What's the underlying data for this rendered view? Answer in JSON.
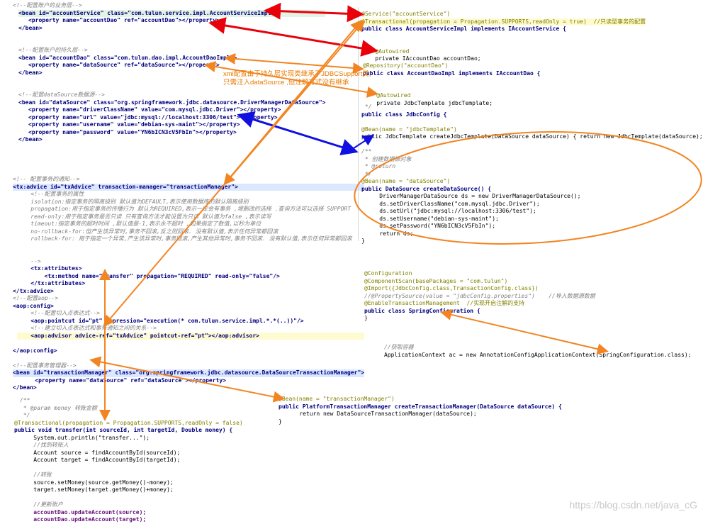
{
  "beans_xml": {
    "service_comment": "<!--配置账户的业务层-->",
    "service_bean": "<bean id=\"accountService\" class=\"com.tulun.service.impl.AccountServiceImpl\">",
    "service_prop": "<property name=\"accountDao\" ref=\"accountDao\"></property>",
    "service_end": "</bean>",
    "dao_comment": "<!--配置账户的持久层-->",
    "dao_bean": "<bean id=\"accountDao\" class=\"com.tulun.dao.impl.AccountDaoImpl\">",
    "dao_prop": "<property name=\"dataSource\" ref=\"dataSource\"></property>",
    "dao_end": "</bean>",
    "ds_comment": "<!--配置dataSource数据源-->",
    "ds_bean": "<bean id=\"dataSource\" class=\"org.springframework.jdbc.datasource.DriverManagerDataSource\">",
    "ds_props": [
      "<property name=\"driverClassName\" value=\"com.mysql.jdbc.Driver\"></property>",
      "<property name=\"url\" value=\"jdbc:mysql://localhost:3306/test\"></property>",
      "<property name=\"username\" value=\"debian-sys-maint\"></property>",
      "<property name=\"password\" value=\"YN6bICN3cV5FbIn\"></property>"
    ],
    "ds_end": "</bean>"
  },
  "tx_xml": {
    "lines": [
      "<!-- 配置事务的通知-->",
      "<tx:advice id=\"txAdvice\" transaction-manager=\"transactionManager\">",
      "    <!--配置事务的属性",
      "    isolation:指定事务的隔离级别 默认值为DEFAULT,表示使用数据库的默认隔离级别",
      "    propagation:用于指定事务的传播行为 默认为REQUIRED,表示一定会有事务 ,增删改的选择 .查询方法可以选择 SUPPORT",
      "    read-only:用于指定事务是否只读 只有查询方法才能设置为只读 默认值为false ,表示读写",
      "    timeout:指定事务的超时时间 ,默认值是-1,表示永不超时 ,如果指定了数值,以秒为单位",
      "    no-rollback-for:但产生该异常时,事务不回滚,反之则回滚. 没有默认值,表示任何异常都回滚",
      "    rollback-for: 用于指定一个异常,产生该异常时,事务回滚,产生其他异常时,事务不回滚. 没有默认值,表示任何异常都回滚",
      "",
      "",
      "    -->",
      "    <tx:attributes>",
      "        <tx:method name=\"transfer\" propagation=\"REQUIRED\" read-only=\"false\"/>",
      "    </tx:attributes>",
      "</tx:advice>",
      "<!--配置aop-->",
      "<aop:config>",
      "    <!--配置切入点表达式-->",
      "    <aop:pointcut id=\"pt\" expression=\"execution(* com.tulun.service.impl.*.*(..))\"/>",
      "    <!--建立切入点表达式和事务通知之间的关系-->",
      "    <aop:advisor advice-ref=\"txAdvice\" pointcut-ref=\"pt\"></aop:advisor>",
      "",
      "</aop:config>",
      "",
      "<!--配置事务管理器-->",
      "<bean id=\"transactionManager\" class=\"org.springframework.jdbc.datasource.DataSourceTransactionManager\">",
      "    <property name=\"dataSource\" ref=\"dataSource\"></property>",
      "</bean>"
    ]
  },
  "transfer_code": {
    "lines": [
      "/**",
      " * @param money 转账金额",
      " */",
      "@Transactional(propagation = Propagation.SUPPORTS,readOnly = false)",
      "public void transfer(int sourceId, int targetId, Double money) {",
      "    System.out.println(\"transfer...\");",
      "    //找到转账人",
      "    Account source = findAccountById(sourceId);",
      "    Account target = findAccountById(targetId);",
      "",
      "    //转账",
      "    source.setMoney(source.getMoney()-money);",
      "    target.setMoney(target.getMoney()+money);",
      "",
      "    //更新账户",
      "    accountDao.updateAccount(source);",
      "    accountDao.updateAccount(target);"
    ]
  },
  "tm_code": {
    "lines": [
      "@Bean(name = \"transactionManager\")",
      "public PlatformTransactionManager createTransactionManager(DataSource dataSource) {",
      "    return new DataSourceTransactionManager(dataSource);",
      "}"
    ]
  },
  "service_code": {
    "lines": [
      "@Service(\"accountService\")",
      "@Transactional(propagation = Propagation.SUPPORTS,readOnly = true)  //只读型事务的配置",
      "public class AccountServiceImpl implements IAccountService {",
      "",
      "",
      "    @Autowired",
      "    private IAccountDao accountDao;"
    ]
  },
  "dao_code": {
    "lines": [
      "@Repository(\"accountDao\")",
      "public class AccountDaoImpl implements IAccountDao {",
      "",
      "",
      "    @Autowired",
      "    private JdbcTemplate jdbcTemplate;"
    ]
  },
  "jdbc_code": {
    "lines": [
      " */",
      "public class JdbcConfig {",
      "",
      "@Bean(name = \"jdbcTemplate\")",
      "public JdbcTemplate createJdbcTemplate(DataSource dataSource) { return new JdbcTemplate(dataSource); }",
      "",
      "/**",
      " * 创建数据源对象",
      " * @return",
      " */",
      "@Bean(name = \"dataSource\")",
      "public DataSource createDataSource() {",
      "    DriverManagerDataSource ds = new DriverManagerDataSource();",
      "    ds.setDriverClassName(\"com.mysql.jdbc.Driver\");",
      "    ds.setUrl(\"jdbc:mysql://localhost:3306/test\");",
      "    ds.setUsername(\"debian-sys-maint\");",
      "    ds.setPassword(\"YN6bICN3cV5FbIn\");",
      "    return ds;",
      "}"
    ]
  },
  "config_code": {
    "lines": [
      "@Configuration",
      "@ComponentScan(basePackages = \"com.tulun\")",
      "@Import({JdbcConfig.class,TransactionConfig.class})",
      "//@PropertySource(value = \"jdbcConfig.properties\")    //导入数据源数据",
      "@EnableTransactionManagement  //实现开启注解的支持",
      "public class SpringConfiguration {",
      "}"
    ]
  },
  "context_code": {
    "lines": [
      "//获取容器",
      "ApplicationContext ac = new AnnotationConfigApplicationContext(SpringConfiguration.class);"
    ]
  },
  "annotation_note": {
    "line1": "xml配置由于持久层实现类继承了JDBCSupport类,",
    "line2": "只需注入dataSource ,但注解方式没有继承"
  },
  "watermark": "https://blog.csdn.net/java_cG",
  "colors": {
    "arrow_red": "#e8000b",
    "arrow_orange": "#f28522",
    "arrow_blue": "#1010e0",
    "xml_tag": "#000080",
    "xml_attr_name": "#0000ff",
    "xml_attr_value": "#008000",
    "annotation": "#808000",
    "comment": "#808080"
  },
  "connectors": [
    {
      "from": "accountService bean",
      "to": "@Service(\"accountService\")",
      "color": "red",
      "kind": "double-arrow"
    },
    {
      "from": "accountDao property",
      "to": "@Autowired IAccountDao accountDao",
      "color": "red",
      "kind": "arrow"
    },
    {
      "from": "accountDao bean",
      "to": "@Repository(\"accountDao\")",
      "color": "orange",
      "kind": "double-arrow"
    },
    {
      "from": "dataSource property",
      "to": "@Autowired JdbcTemplate jdbcTemplate",
      "color": "orange",
      "kind": "arrow"
    },
    {
      "from": "dataSource bean",
      "to": "@Bean(name = \"dataSource\")",
      "color": "blue",
      "kind": "double-arrow"
    },
    {
      "from": "tx:advice",
      "to": "@Transactional on AccountServiceImpl",
      "color": "orange",
      "kind": "double-arrow"
    },
    {
      "from": "tx:method transfer",
      "to": "@Transactional on transfer()",
      "color": "orange",
      "kind": "double-arrow"
    },
    {
      "from": "aop:advisor",
      "to": "@Transactional on AccountServiceImpl",
      "color": "orange",
      "kind": "double-arrow"
    },
    {
      "from": "transactionManager bean",
      "to": "@Bean(name = \"transactionManager\")",
      "color": "orange",
      "kind": "double-arrow"
    },
    {
      "from": "@EnableTransactionManagement SpringConfiguration",
      "to": "SpringConfiguration.class",
      "color": "orange",
      "kind": "double-arrow"
    }
  ]
}
